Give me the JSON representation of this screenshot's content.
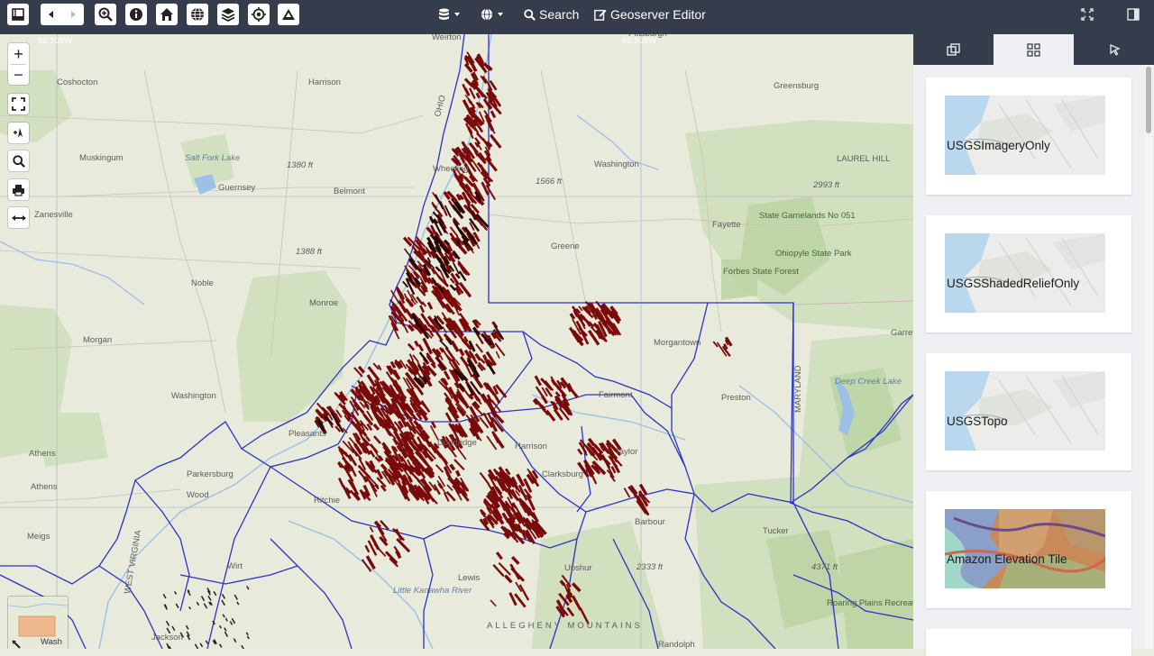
{
  "toolbar": {
    "search_label": "Search",
    "editor_label": "Geoserver Editor",
    "icons": [
      "toggle-sidebar-icon",
      "back-icon",
      "forward-icon",
      "zoom-icon",
      "info-icon",
      "home-icon",
      "globe-icon",
      "layers-icon",
      "locate-icon",
      "terrain-icon",
      "database-icon",
      "basemap-globe-icon",
      "search-icon",
      "edit-icon",
      "fullscreen-icon",
      "panel-toggle-icon"
    ]
  },
  "map": {
    "coords_top_left": "82.109W",
    "coords_top_center": "80.909W",
    "places": [
      {
        "text": "Weirton",
        "cls": ""
      },
      {
        "text": "Pittsburgh",
        "cls": ""
      },
      {
        "text": "Coshocton",
        "cls": ""
      },
      {
        "text": "Harrison",
        "cls": ""
      },
      {
        "text": "Greensburg",
        "cls": ""
      },
      {
        "text": "Muskingum",
        "cls": ""
      },
      {
        "text": "Salt Fork Lake",
        "cls": "water"
      },
      {
        "text": "1380 ft",
        "cls": "it"
      },
      {
        "text": "Wheeling",
        "cls": ""
      },
      {
        "text": "Washington",
        "cls": ""
      },
      {
        "text": "1566 ft",
        "cls": "it"
      },
      {
        "text": "LAUREL HILL",
        "cls": ""
      },
      {
        "text": "2993 ft",
        "cls": "it"
      },
      {
        "text": "Guernsey",
        "cls": ""
      },
      {
        "text": "Belmont",
        "cls": ""
      },
      {
        "text": "Zanesville",
        "cls": ""
      },
      {
        "text": "Fayette",
        "cls": ""
      },
      {
        "text": "State Gamelands No 051",
        "cls": "green"
      },
      {
        "text": "Ohiopyle State Park",
        "cls": "green"
      },
      {
        "text": "1388 ft",
        "cls": "it"
      },
      {
        "text": "Greene",
        "cls": ""
      },
      {
        "text": "Forbes State Forest",
        "cls": "green"
      },
      {
        "text": "Noble",
        "cls": ""
      },
      {
        "text": "Monroe",
        "cls": ""
      },
      {
        "text": "Morgan",
        "cls": ""
      },
      {
        "text": "Morgantown",
        "cls": ""
      },
      {
        "text": "Garrett",
        "cls": ""
      },
      {
        "text": "Washington",
        "cls": ""
      },
      {
        "text": "Fairmont",
        "cls": ""
      },
      {
        "text": "Preston",
        "cls": ""
      },
      {
        "text": "Deep Creek Lake",
        "cls": "water"
      },
      {
        "text": "Athens",
        "cls": ""
      },
      {
        "text": "Pleasants",
        "cls": ""
      },
      {
        "text": "Parkersburg",
        "cls": ""
      },
      {
        "text": "Taylor",
        "cls": ""
      },
      {
        "text": "Clarksburg",
        "cls": ""
      },
      {
        "text": "Wood",
        "cls": ""
      },
      {
        "text": "Ritchie",
        "cls": ""
      },
      {
        "text": "Barbour",
        "cls": ""
      },
      {
        "text": "Athens",
        "cls": ""
      },
      {
        "text": "Tucker",
        "cls": ""
      },
      {
        "text": "Meigs",
        "cls": ""
      },
      {
        "text": "Wirt",
        "cls": ""
      },
      {
        "text": "Upshur",
        "cls": ""
      },
      {
        "text": "2333 ft",
        "cls": "it"
      },
      {
        "text": "4371 ft",
        "cls": "it"
      },
      {
        "text": "Jackson",
        "cls": ""
      },
      {
        "text": "ALLEGHENY MOUNTAINS",
        "cls": ""
      },
      {
        "text": "Randolph",
        "cls": ""
      },
      {
        "text": "MARYLAND",
        "cls": ""
      },
      {
        "text": "OHIO",
        "cls": ""
      },
      {
        "text": "WEST VIRGINIA",
        "cls": ""
      },
      {
        "text": "Lewis",
        "cls": ""
      },
      {
        "text": "Doddridge",
        "cls": ""
      },
      {
        "text": "Harrison",
        "cls": ""
      },
      {
        "text": "Little Kanawha River",
        "cls": "water"
      },
      {
        "text": "Roaring Plains Recreation Area",
        "cls": "green"
      }
    ],
    "overview_label": "Wash"
  },
  "controls": {
    "zoom_in": "+",
    "zoom_out": "−"
  },
  "panel": {
    "tabs": [
      "layers-tab",
      "basemaps-tab",
      "select-tab"
    ],
    "active_tab": 1,
    "basemaps": [
      {
        "label": "USGSImageryOnly",
        "style": "light"
      },
      {
        "label": "USGSShadedReliefOnly",
        "style": "light"
      },
      {
        "label": "USGSTopo",
        "style": "light"
      },
      {
        "label": "Amazon Elevation Tile",
        "style": "elev"
      }
    ]
  },
  "colors": {
    "toolbar_bg": "#353c4b",
    "wells": "#7a0a0a",
    "boundaries": "#2a33c9",
    "forest": "#c8dcb3"
  }
}
